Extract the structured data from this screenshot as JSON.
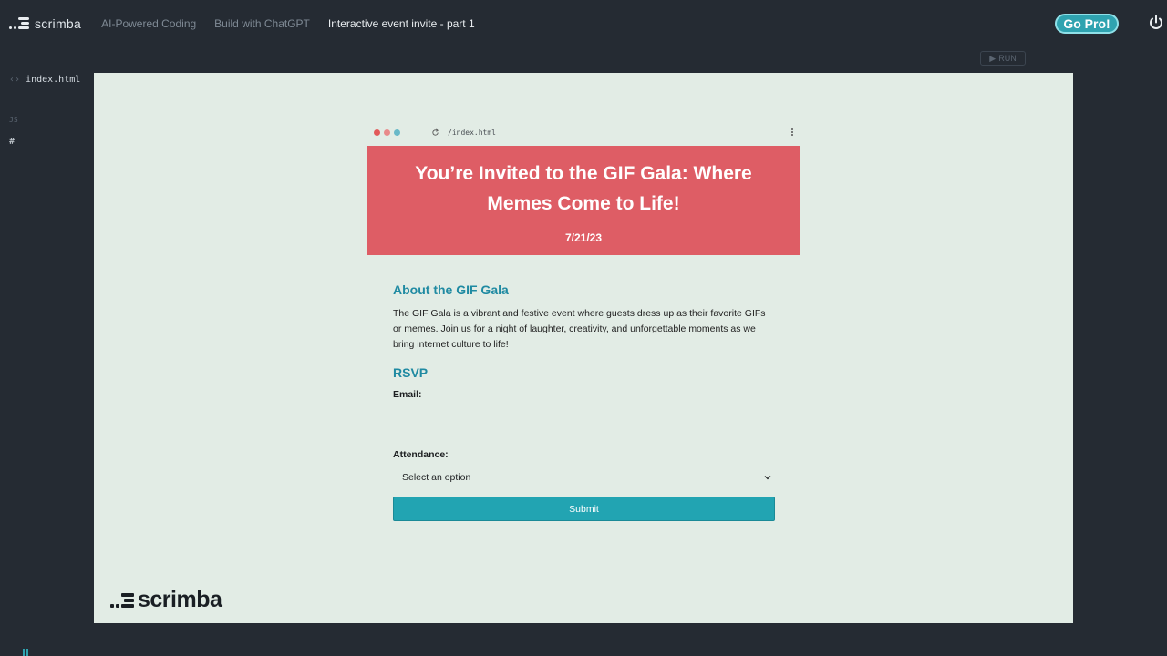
{
  "app": {
    "brand": "scrimba",
    "breadcrumbs": [
      "AI-Powered Coding",
      "Build with ChatGPT",
      "Interactive event invite - part 1"
    ],
    "go_pro_label": "Go Pro!",
    "colors": {
      "accent": "#2fa3b0",
      "background": "#252b33",
      "preview_bg": "#e2ece5"
    }
  },
  "editor": {
    "run_label": "RUN",
    "files": [
      {
        "name": "index.html",
        "icon": "html-file-icon"
      },
      {
        "name": "JS",
        "icon": "js-file-icon"
      },
      {
        "name": "#",
        "icon": "css-file-icon"
      }
    ]
  },
  "preview": {
    "url": "/index.html",
    "hero": {
      "title": "You’re Invited to the GIF Gala: Where Memes Come to Life!",
      "date": "7/21/23",
      "color": "#de5d65"
    },
    "about": {
      "heading": "About the GIF Gala",
      "text": "The GIF Gala is a vibrant and festive event where guests dress up as their favorite GIFs or memes. Join us for a night of laughter, creativity, and unforgettable moments as we bring internet culture to life!"
    },
    "rsvp": {
      "heading": "RSVP",
      "email_label": "Email:",
      "email_value": "",
      "attendance_label": "Attendance:",
      "attendance_selected": "Select an option",
      "submit_label": "Submit"
    },
    "watermark": "scrimba"
  }
}
